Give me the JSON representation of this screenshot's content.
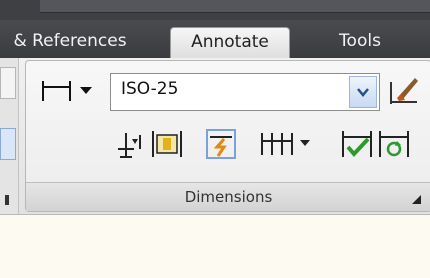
{
  "tabs": {
    "references": "& References",
    "annotate": "Annotate",
    "tools": "Tools"
  },
  "dimensions_panel": {
    "style_value": "ISO-25",
    "footer_label": "Dimensions"
  },
  "icons": {
    "dimension": "linear-dimension-icon",
    "dropdown": "chevron-down-icon",
    "style_manager": "dimension-style-icon",
    "baseline": "baseline-dimension-icon",
    "inspect": "inspect-dimension-icon",
    "break": "dimension-break-icon",
    "continue": "continue-dimension-icon",
    "reassociate": "reassociate-dimension-icon",
    "update": "update-dimension-icon",
    "launcher": "panel-launcher-icon"
  }
}
